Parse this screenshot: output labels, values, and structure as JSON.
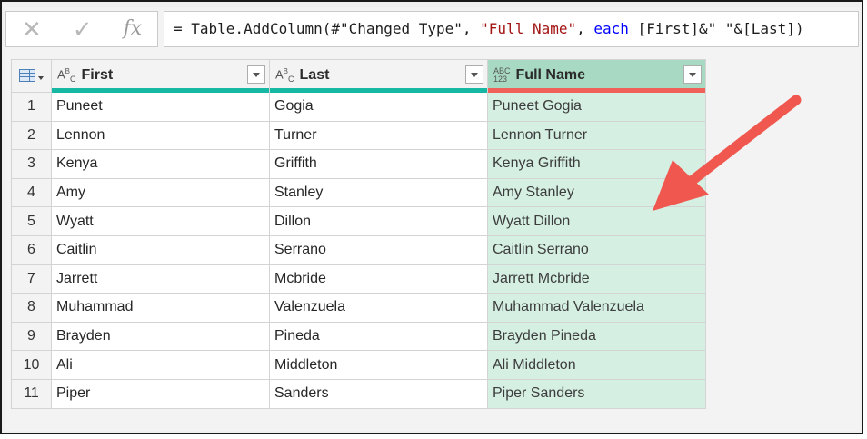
{
  "formula_bar": {
    "cancel_icon": "✕",
    "confirm_icon": "✓",
    "fx_label": "fx",
    "formula_prefix": "= Table.AddColumn(#\"Changed Type\", ",
    "formula_string1": "\"Full Name\"",
    "formula_sep": ", ",
    "formula_keyword": "each",
    "formula_suffix": " [First]&\" \"&[Last])"
  },
  "columns": [
    {
      "label": "First",
      "type_icon": "ABC-icon"
    },
    {
      "label": "Last",
      "type_icon": "ABC-icon"
    },
    {
      "label": "Full Name",
      "type_icon": "ABC123-icon"
    }
  ],
  "rows": [
    {
      "n": "1",
      "first": "Puneet",
      "last": "Gogia",
      "full": "Puneet Gogia"
    },
    {
      "n": "2",
      "first": "Lennon",
      "last": "Turner",
      "full": "Lennon Turner"
    },
    {
      "n": "3",
      "first": "Kenya",
      "last": "Griffith",
      "full": "Kenya Griffith"
    },
    {
      "n": "4",
      "first": "Amy",
      "last": "Stanley",
      "full": "Amy Stanley"
    },
    {
      "n": "5",
      "first": "Wyatt",
      "last": "Dillon",
      "full": "Wyatt Dillon"
    },
    {
      "n": "6",
      "first": "Caitlin",
      "last": "Serrano",
      "full": "Caitlin Serrano"
    },
    {
      "n": "7",
      "first": "Jarrett",
      "last": "Mcbride",
      "full": "Jarrett Mcbride"
    },
    {
      "n": "8",
      "first": "Muhammad",
      "last": "Valenzuela",
      "full": "Muhammad Valenzuela"
    },
    {
      "n": "9",
      "first": "Brayden",
      "last": "Pineda",
      "full": "Brayden Pineda"
    },
    {
      "n": "10",
      "first": "Ali",
      "last": "Middleton",
      "full": "Ali Middleton"
    },
    {
      "n": "11",
      "first": "Piper",
      "last": "Sanders",
      "full": "Piper Sanders"
    }
  ],
  "colors": {
    "column_bar": "#16b8a3",
    "selected_bar": "#f06259",
    "selected_header": "#a8d9c3",
    "selected_cells": "#d5efe2",
    "annotation_arrow": "#f0584f"
  }
}
